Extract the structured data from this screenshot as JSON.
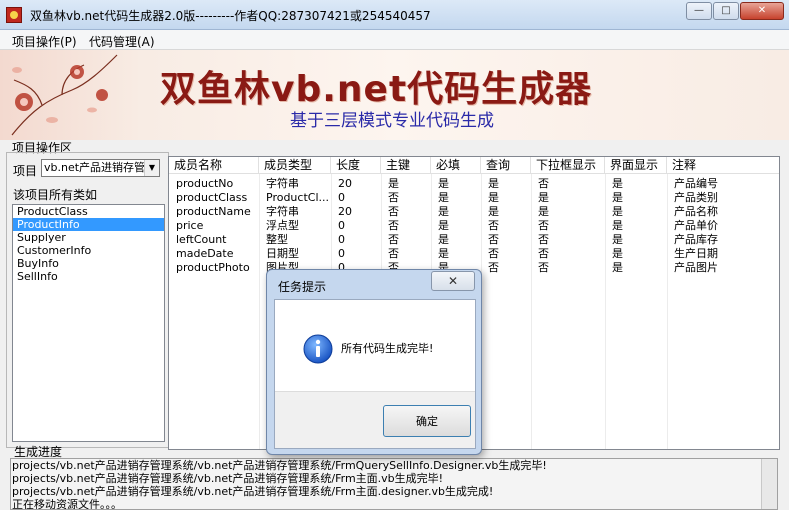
{
  "window": {
    "title": "双鱼林vb.net代码生成器2.0版---------作者QQ:287307421或254540457",
    "minimize_glyph": "—",
    "maximize_glyph": "□",
    "close_glyph": "✕"
  },
  "menu": {
    "items": [
      {
        "label": "项目操作(P)"
      },
      {
        "label": "代码管理(A)"
      }
    ]
  },
  "banner": {
    "title": "双鱼林vb.net代码生成器",
    "subtitle": "基于三层模式专业代码生成"
  },
  "project_area": {
    "group_label": "项目操作区",
    "project_label": "项目",
    "project_selected": "vb.net产品进销存管",
    "classes_label": "该项目所有类如",
    "classes": [
      "ProductClass",
      "ProductInfo",
      "Supplyer",
      "CustomerInfo",
      "BuyInfo",
      "SellInfo"
    ],
    "selected_class": "ProductInfo"
  },
  "grid": {
    "columns": [
      "成员名称",
      "成员类型",
      "长度",
      "主键",
      "必填",
      "查询",
      "下拉框显示",
      "界面显示",
      "注释"
    ],
    "rows": [
      [
        "productNo",
        "字符串",
        "20",
        "是",
        "是",
        "是",
        "否",
        "是",
        "产品编号"
      ],
      [
        "productClass",
        "ProductCl...",
        "0",
        "否",
        "是",
        "是",
        "是",
        "是",
        "产品类别"
      ],
      [
        "productName",
        "字符串",
        "20",
        "否",
        "是",
        "是",
        "是",
        "是",
        "产品名称"
      ],
      [
        "price",
        "浮点型",
        "0",
        "否",
        "是",
        "否",
        "否",
        "是",
        "产品单价"
      ],
      [
        "leftCount",
        "整型",
        "0",
        "否",
        "是",
        "否",
        "否",
        "是",
        "产品库存"
      ],
      [
        "madeDate",
        "日期型",
        "0",
        "否",
        "是",
        "否",
        "否",
        "是",
        "生产日期"
      ],
      [
        "productPhoto",
        "图片型",
        "0",
        "否",
        "是",
        "否",
        "否",
        "是",
        "产品图片"
      ]
    ]
  },
  "progress": {
    "group_label": "生成进度",
    "lines": [
      "projects/vb.net产品进销存管理系统/vb.net产品进销存管理系统/FrmQuerySellInfo.Designer.vb生成完毕!",
      "projects/vb.net产品进销存管理系统/vb.net产品进销存管理系统/Frm主面.vb生成完毕!",
      "projects/vb.net产品进销存管理系统/vb.net产品进销存管理系统/Frm主面.designer.vb生成完成!",
      "正在移动资源文件。。。"
    ]
  },
  "dialog": {
    "title": "任务提示",
    "close_glyph": "✕",
    "message": "所有代码生成完毕!",
    "ok_label": "确定",
    "icon": "info-icon"
  },
  "colors": {
    "selection": "#3399ff",
    "banner_title": "#8a1a14",
    "banner_subtitle": "#2a2aa8"
  }
}
